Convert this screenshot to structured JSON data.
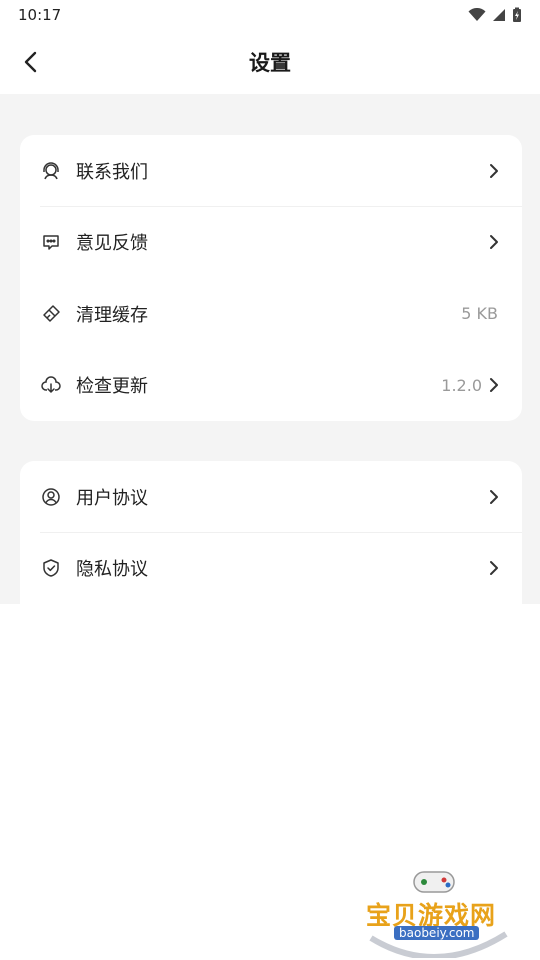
{
  "status_bar": {
    "time": "10:17"
  },
  "header": {
    "title": "设置"
  },
  "group1": [
    {
      "label": "联系我们",
      "value": "",
      "icon": "headset-icon",
      "chevron": true
    },
    {
      "label": "意见反馈",
      "value": "",
      "icon": "message-icon",
      "chevron": true
    },
    {
      "label": "清理缓存",
      "value": "5 KB",
      "icon": "broom-icon",
      "chevron": false
    },
    {
      "label": "检查更新",
      "value": "1.2.0",
      "icon": "cloud-download-icon",
      "chevron": true
    }
  ],
  "group2": [
    {
      "label": "用户协议",
      "value": "",
      "icon": "user-circle-icon",
      "chevron": true
    },
    {
      "label": "隐私协议",
      "value": "",
      "icon": "shield-icon",
      "chevron": true
    }
  ],
  "watermark": {
    "name": "宝贝游戏网",
    "url": "baobeiy.com"
  },
  "colors": {
    "background": "#f4f4f4",
    "card": "#ffffff",
    "secondary_text": "#9a9a9a",
    "watermark": "#e8a21a"
  }
}
